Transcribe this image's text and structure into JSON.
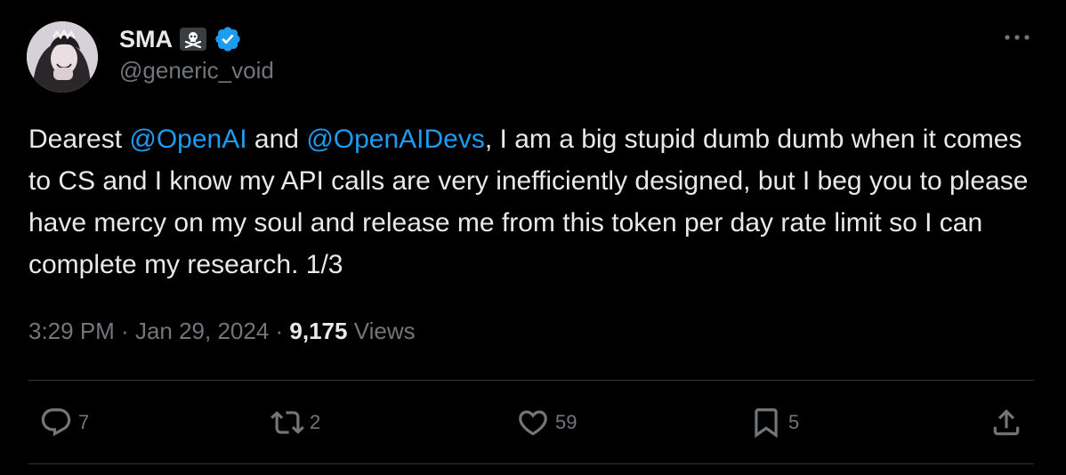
{
  "author": {
    "name": "SMA",
    "emoji_icon": "skull-and-crossbones-icon",
    "verified_icon": "verified-badge-icon",
    "handle": "@generic_void"
  },
  "tweet": {
    "t1": "Dearest ",
    "mention1": "@OpenAI",
    "t2": " and ",
    "mention2": "@OpenAIDevs",
    "t3": ", I am a big stupid dumb dumb when it comes to CS and I know my API calls are very inefficiently designed, but I beg you to please have mercy on my soul and release me from this token per day rate limit so I can complete my research. 1/3"
  },
  "meta": {
    "time": "3:29 PM",
    "sep1": " · ",
    "date": "Jan 29, 2024",
    "sep2": " · ",
    "views_count": "9,175",
    "views_label": " Views"
  },
  "actions": {
    "replies": "7",
    "reposts": "2",
    "likes": "59",
    "bookmarks": "5"
  },
  "colors": {
    "background": "#000000",
    "text": "#e7e9ea",
    "secondary": "#71767b",
    "accent": "#1d9bf0",
    "divider": "#2f3336"
  }
}
